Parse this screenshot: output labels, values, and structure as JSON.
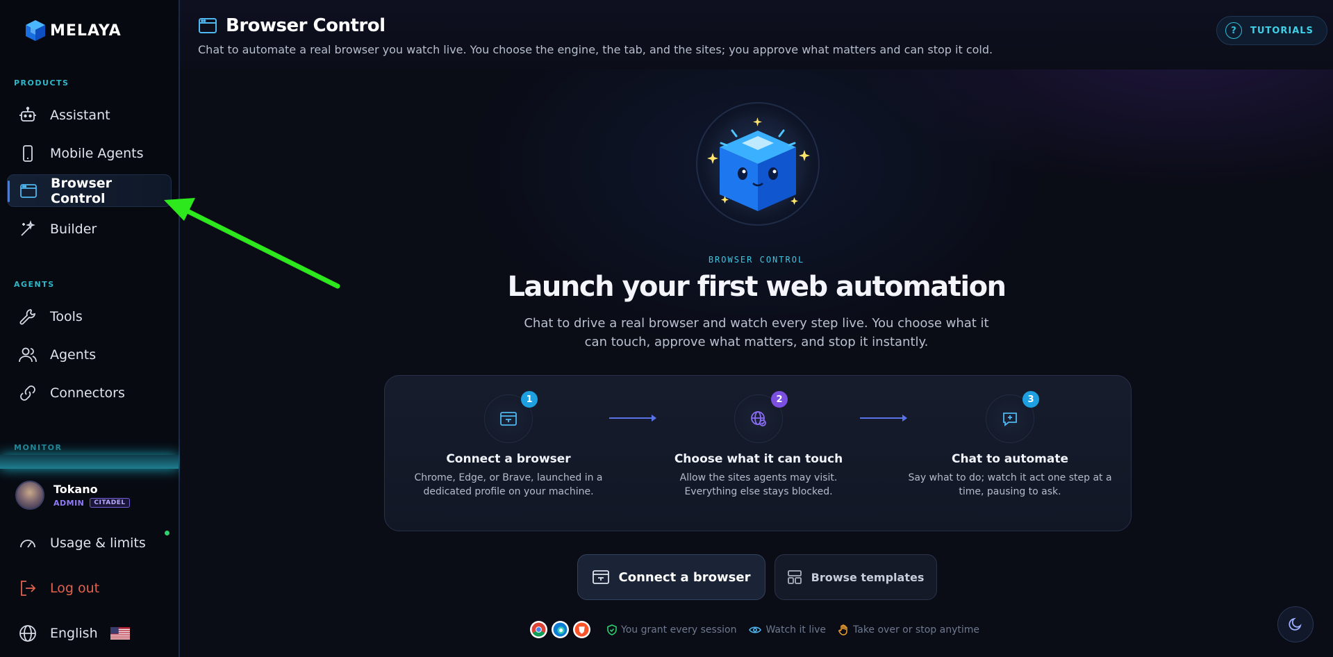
{
  "app": {
    "brand": "MELAYA"
  },
  "sidebar": {
    "sections": {
      "products": "PRODUCTS",
      "agents": "AGENTS",
      "monitor": "MONITOR"
    },
    "items": [
      {
        "label": "Assistant",
        "icon": "robot-icon"
      },
      {
        "label": "Mobile Agents",
        "icon": "phone-icon"
      },
      {
        "label": "Browser Control",
        "icon": "browser-window-icon",
        "active": true
      },
      {
        "label": "Builder",
        "icon": "wand-icon"
      },
      {
        "label": "Tools",
        "icon": "wrench-icon"
      },
      {
        "label": "Agents",
        "icon": "users-icon"
      },
      {
        "label": "Connectors",
        "icon": "link-icon"
      }
    ],
    "user": {
      "name": "Tokano",
      "role": "ADMIN",
      "badge": "CITADEL"
    },
    "footer_items": {
      "usage": "Usage & limits",
      "logout": "Log out",
      "language": "English"
    }
  },
  "header": {
    "title": "Browser Control",
    "subtitle": "Chat to automate a real browser you watch live. You choose the engine, the tab, and the sites; you approve what matters and can stop it cold.",
    "tutorials": "TUTORIALS"
  },
  "hero": {
    "eyebrow": "BROWSER CONTROL",
    "title": "Launch your first web automation",
    "description": "Chat to drive a real browser and watch every step live. You choose what it can touch, approve what matters, and stop it instantly."
  },
  "steps": [
    {
      "num": "1",
      "title": "Connect a browser",
      "desc": "Chrome, Edge, or Brave, launched in a dedicated profile on your machine.",
      "color": "#1e9fe0"
    },
    {
      "num": "2",
      "title": "Choose what it can touch",
      "desc": "Allow the sites agents may visit. Everything else stays blocked.",
      "color": "#7b4fe0"
    },
    {
      "num": "3",
      "title": "Chat to automate",
      "desc": "Say what to do; watch it act one step at a time, pausing to ask.",
      "color": "#1e9fe0"
    }
  ],
  "actions": {
    "connect": "Connect a browser",
    "templates": "Browse templates"
  },
  "footer": {
    "grant": "You grant every session",
    "watch": "Watch it live",
    "takeover": "Take over or stop anytime"
  },
  "colors": {
    "accent_cyan": "#3fc6e0",
    "annotation_arrow": "#2ee81e",
    "logout": "#e2624f",
    "active_bar": "#3b7df5"
  }
}
